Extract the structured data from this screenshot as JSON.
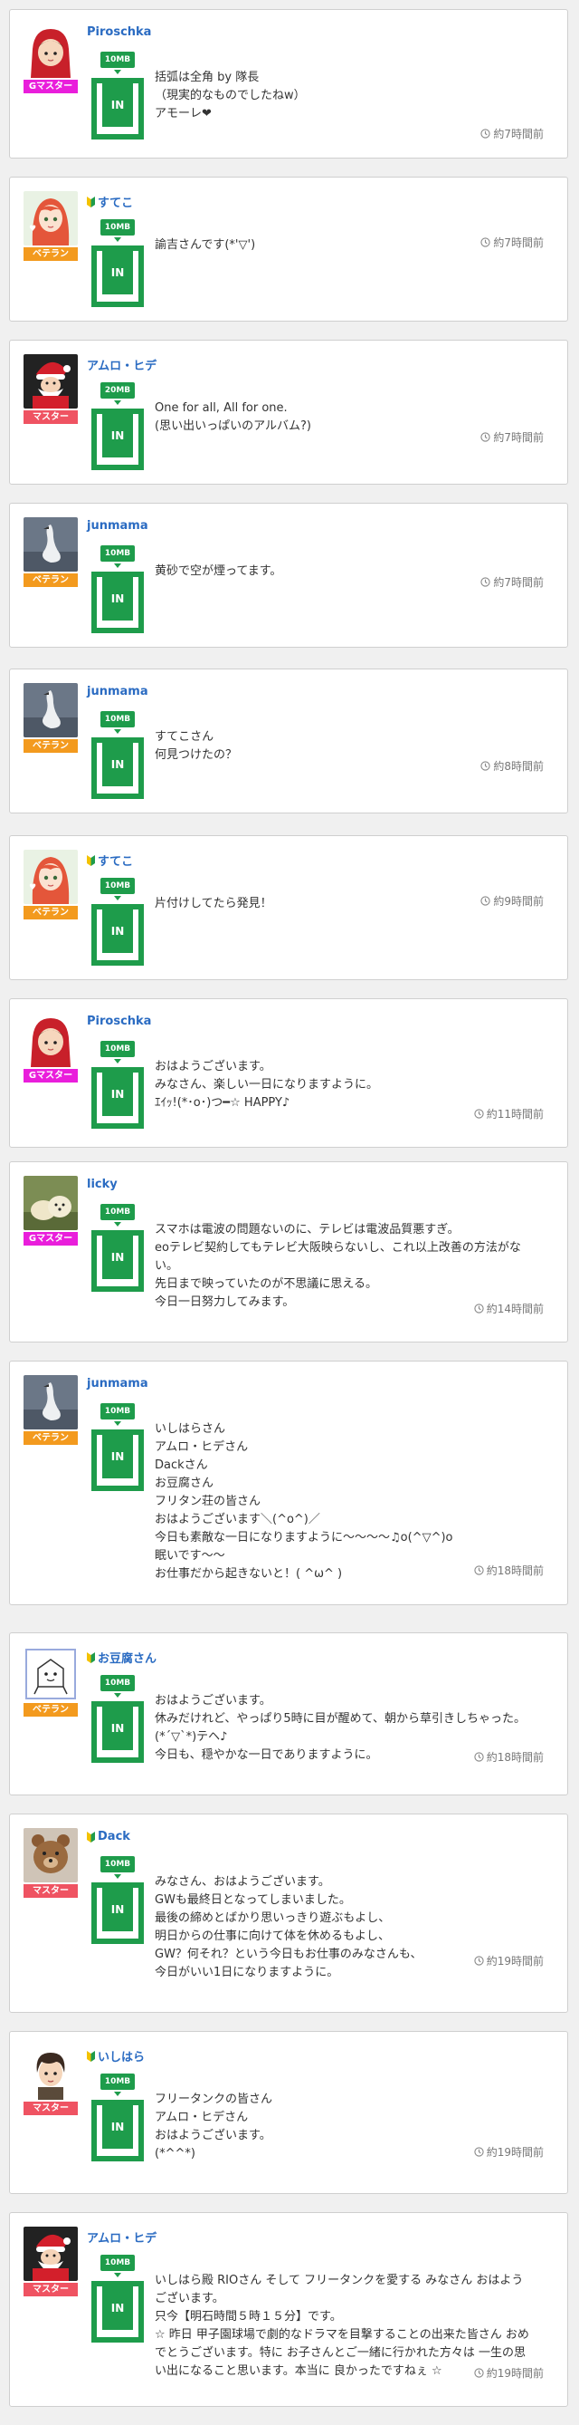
{
  "colors": {
    "username": "#2a6bc2",
    "capacity_green": "#1e9c4b",
    "rank_gm_master": "#e91edb",
    "rank_veteran": "#f39a1e",
    "rank_master": "#ef5362"
  },
  "posts": [
    {
      "username": "Piroschka",
      "beginner": false,
      "avatar": "redhood",
      "rank": "Gマスター",
      "rank_kind": "gm",
      "capacity": "10MB",
      "inbox": "IN",
      "message": "括弧は全角 by 隊長\n（現実的なものでしたねw）\nアモーレ❤",
      "time": "約7時間前"
    },
    {
      "username": "すてこ",
      "beginner": true,
      "avatar": "animegirl",
      "rank": "ベテラン",
      "rank_kind": "veteran",
      "capacity": "10MB",
      "inbox": "IN",
      "message": "諭吉さんです(*'▽')",
      "time": "約7時間前"
    },
    {
      "username": "アムロ・ヒデ",
      "beginner": false,
      "avatar": "santa",
      "rank": "マスター",
      "rank_kind": "master",
      "capacity": "20MB",
      "inbox": "IN",
      "message": "One for all, All for one.\n(思い出いっぱいのアルバム?)",
      "time": "約7時間前"
    },
    {
      "username": "junmama",
      "beginner": false,
      "avatar": "swan",
      "rank": "ベテラン",
      "rank_kind": "veteran",
      "capacity": "10MB",
      "inbox": "IN",
      "message": "黄砂で空が煙ってます。",
      "time": "約7時間前"
    },
    {
      "username": "junmama",
      "beginner": false,
      "avatar": "swan",
      "rank": "ベテラン",
      "rank_kind": "veteran",
      "capacity": "10MB",
      "inbox": "IN",
      "message": "すてこさん\n何見つけたの？",
      "time": "約8時間前"
    },
    {
      "username": "すてこ",
      "beginner": true,
      "avatar": "animegirl",
      "rank": "ベテラン",
      "rank_kind": "veteran",
      "capacity": "10MB",
      "inbox": "IN",
      "message": "片付けしてたら発見！",
      "time": "約9時間前"
    },
    {
      "username": "Piroschka",
      "beginner": false,
      "avatar": "redhood",
      "rank": "Gマスター",
      "rank_kind": "gm",
      "capacity": "10MB",
      "inbox": "IN",
      "message": "おはようございます。\nみなさん、楽しい一日になりますように。\nｴｲｯ!(*･o･)つ━☆ HAPPY♪",
      "time": "約11時間前"
    },
    {
      "username": "licky",
      "beginner": false,
      "avatar": "dog",
      "rank": "Gマスター",
      "rank_kind": "gm",
      "capacity": "10MB",
      "inbox": "IN",
      "message": "スマホは電波の問題ないのに、テレビは電波品質悪すぎ。\neoテレビ契約してもテレビ大阪映らないし、これ以上改善の方法がない。\n先日まで映っていたのが不思議に思える。\n今日一日努力してみます。",
      "time": "約14時間前"
    },
    {
      "username": "junmama",
      "beginner": false,
      "avatar": "swan",
      "rank": "ベテラン",
      "rank_kind": "veteran",
      "capacity": "10MB",
      "inbox": "IN",
      "message": "いしはらさん\nアムロ・ヒデさん\nDackさん\nお豆腐さん\nフリタン荘の皆さん\nおはようございます＼(^o^)／\n今日も素敵な一日になりますように〜〜〜〜♫o(^▽^)o\n眠いです〜〜\nお仕事だから起きないと！( ^ω^ )",
      "time": "約18時間前"
    },
    {
      "username": "お豆腐さん",
      "beginner": true,
      "avatar": "tofu",
      "rank": "ベテラン",
      "rank_kind": "veteran",
      "capacity": "10MB",
      "inbox": "IN",
      "message": "おはようございます。\n休みだけれど、やっぱり5時に目が醒めて、朝から草引きしちゃった。(*´▽`*)テヘ♪\n今日も、穏やかな一日でありますように。",
      "time": "約18時間前"
    },
    {
      "username": "Dack",
      "beginner": true,
      "avatar": "bear",
      "rank": "マスター",
      "rank_kind": "master",
      "capacity": "10MB",
      "inbox": "IN",
      "message": "みなさん、おはようございます。\nGWも最終日となってしまいました。\n最後の締めとばかり思いっきり遊ぶもよし、\n明日からの仕事に向けて体を休めるもよし、\nGW？何それ？という今日もお仕事のみなさんも、\n今日がいい1日になりますように。",
      "time": "約19時間前"
    },
    {
      "username": "いしはら",
      "beginner": true,
      "avatar": "boy",
      "rank": "マスター",
      "rank_kind": "master",
      "capacity": "10MB",
      "inbox": "IN",
      "message": "フリータンクの皆さん\nアムロ・ヒデさん\nおはようございます。\n(*^^*)",
      "time": "約19時間前"
    },
    {
      "username": "アムロ・ヒデ",
      "beginner": false,
      "avatar": "santa",
      "rank": "マスター",
      "rank_kind": "master",
      "capacity": "10MB",
      "inbox": "IN",
      "message": "いしはら殿 RIOさん そして フリータンクを愛する みなさん おはようございます。\n只今【明石時間５時１５分】です。\n☆ 昨日 甲子園球場で劇的なドラマを目撃することの出来た皆さん おめでとうございます。特に お子さんとご一緒に行かれた方々は 一生の思い出になること思います。本当に 良かったですねぇ ☆",
      "time": "約19時間前"
    }
  ]
}
